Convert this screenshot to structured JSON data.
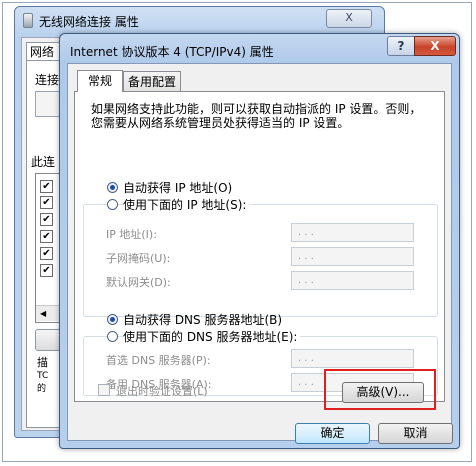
{
  "background_window": {
    "title": "无线网络连接 属性",
    "close_label": "X",
    "tab_label": "网络",
    "connect_label": "连接",
    "items_label": "此连",
    "description_label": "描",
    "description_text": "TC\n的"
  },
  "dialog": {
    "title": "Internet 协议版本 4 (TCP/IPv4) 属性",
    "help_label": "?",
    "close_label": "X",
    "tabs": [
      {
        "label": "常规",
        "active": true
      },
      {
        "label": "备用配置",
        "active": false
      }
    ],
    "intro": "如果网络支持此功能，则可以获取自动指派的 IP 设置。否则，您需要从网络系统管理员处获得适当的 IP 设置。",
    "ip_section": {
      "auto_label": "自动获得 IP 地址(O)",
      "manual_label": "使用下面的 IP 地址(S):",
      "selected": "auto",
      "fields": [
        {
          "label": "IP 地址(I):",
          "value": "   .   .   ."
        },
        {
          "label": "子网掩码(U):",
          "value": "   .   .   ."
        },
        {
          "label": "默认网关(D):",
          "value": "   .   .   ."
        }
      ]
    },
    "dns_section": {
      "auto_label": "自动获得 DNS 服务器地址(B)",
      "manual_label": "使用下面的 DNS 服务器地址(E):",
      "selected": "auto",
      "fields": [
        {
          "label": "首选 DNS 服务器(P):",
          "value": "   .   .   ."
        },
        {
          "label": "备用 DNS 服务器(A):",
          "value": "   .   .   ."
        }
      ]
    },
    "validate_label": "退出时验证设置(L)",
    "validate_checked": false,
    "advanced_label": "高级(V)...",
    "ok_label": "确定",
    "cancel_label": "取消"
  },
  "colors": {
    "highlight": "#e02020",
    "title_gradient": "#aec9ea",
    "close_button": "#c8432a"
  }
}
